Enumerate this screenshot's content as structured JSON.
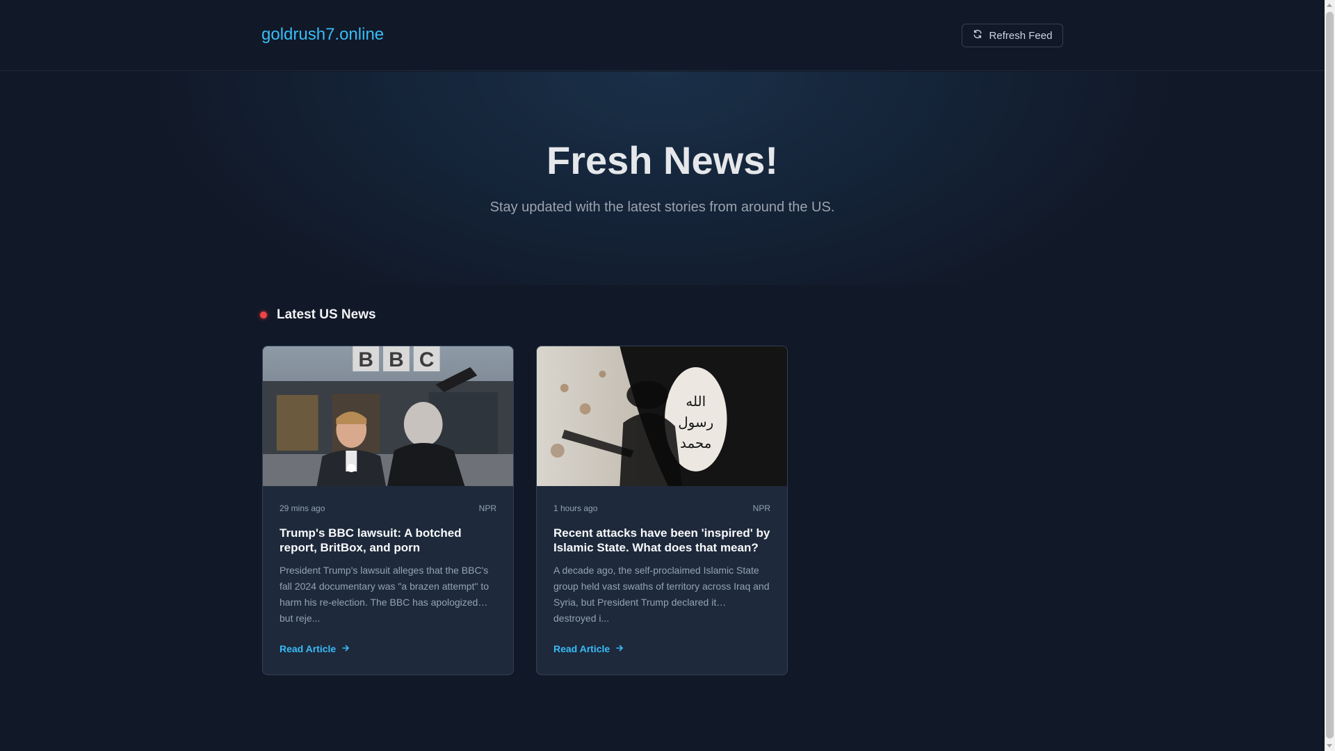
{
  "header": {
    "brand": "goldrush7.online",
    "refresh_label": "Refresh Feed"
  },
  "hero": {
    "title": "Fresh News!",
    "subtitle": "Stay updated with the latest stories from around the US."
  },
  "section": {
    "title": "Latest US News"
  },
  "articles": [
    {
      "time": "29 mins ago",
      "source": "NPR",
      "title": "Trump's BBC lawsuit: A botched report, BritBox, and porn",
      "description": "President Trump's lawsuit alleges that the BBC's fall 2024 documentary was \"a brazen attempt\" to harm his re-election. The BBC has apologized… but reje...",
      "link_label": "Read Article",
      "image_sign_text": "BBC"
    },
    {
      "time": "1 hours ago",
      "source": "NPR",
      "title": "Recent attacks have been 'inspired' by Islamic State. What does that mean?",
      "description": "A decade ago, the self-proclaimed Islamic State group held vast swaths of territory across Iraq and Syria, but President Trump declared it… destroyed i...",
      "link_label": "Read Article",
      "image_flag_text": "الله رسول محمد"
    }
  ],
  "colors": {
    "accent": "#38bdf8",
    "background": "#111827",
    "card": "#1e293b",
    "live_dot": "#ef4444"
  }
}
